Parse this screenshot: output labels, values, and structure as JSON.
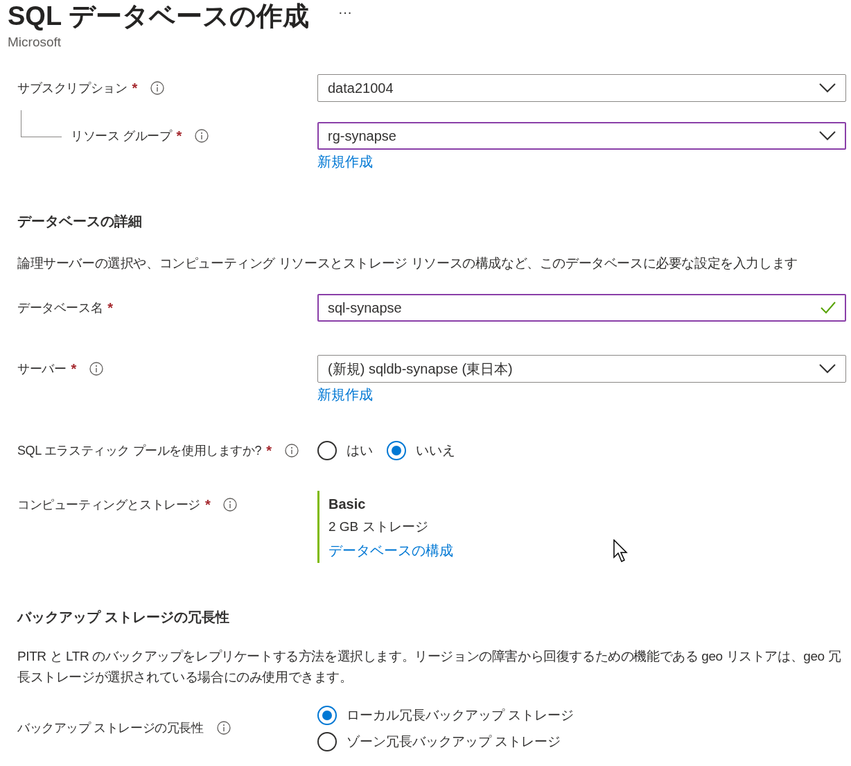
{
  "header": {
    "title": "SQL データベースの作成",
    "more": "···",
    "publisher": "Microsoft"
  },
  "project_fields": [
    {
      "kind": "dropdown",
      "label": "サブスクリプション",
      "required_mark": "*",
      "info": true,
      "value": "data21004",
      "focused": false,
      "children": [
        {
          "kind": "dropdown",
          "label": "リソース グループ",
          "required_mark": "*",
          "info": true,
          "value": "rg-synapse",
          "focused": true,
          "link": "新規作成"
        }
      ]
    }
  ],
  "sections": [
    {
      "heading": "データベースの詳細",
      "description": "論理サーバーの選択や、コンピューティング リソースとストレージ リソースの構成など、このデータベースに必要な設定を入力します",
      "fields": [
        {
          "kind": "textbox",
          "label": "データベース名",
          "required_mark": "*",
          "info": false,
          "value": "sql-synapse",
          "focused": true,
          "valid": true
        },
        {
          "kind": "dropdown",
          "label": "サーバー",
          "required_mark": "*",
          "info": true,
          "value": "(新規) sqldb-synapse (東日本)",
          "focused": false,
          "link": "新規作成"
        },
        {
          "kind": "radio",
          "label": "SQL エラスティック プールを使用しますか?",
          "required_mark": "*",
          "info": true,
          "stacked": false,
          "options": [
            {
              "label": "はい",
              "selected": false
            },
            {
              "label": "いいえ",
              "selected": true
            }
          ]
        },
        {
          "kind": "summary",
          "label": "コンピューティングとストレージ",
          "required_mark": "*",
          "info": true,
          "tier": "Basic",
          "detail": "2 GB ストレージ",
          "link": "データベースの構成"
        }
      ]
    },
    {
      "heading": "バックアップ ストレージの冗長性",
      "description": "PITR と LTR のバックアップをレプリケートする方法を選択します。リージョンの障害から回復するための機能である geo リストアは、geo 冗長ストレージが選択されている場合にのみ使用できます。",
      "fields": [
        {
          "kind": "radio",
          "label": "バックアップ ストレージの冗長性",
          "info": true,
          "stacked": true,
          "options": [
            {
              "label": "ローカル冗長バックアップ ストレージ",
              "selected": true
            },
            {
              "label": "ゾーン冗長バックアップ ストレージ",
              "selected": false
            }
          ]
        }
      ]
    }
  ]
}
